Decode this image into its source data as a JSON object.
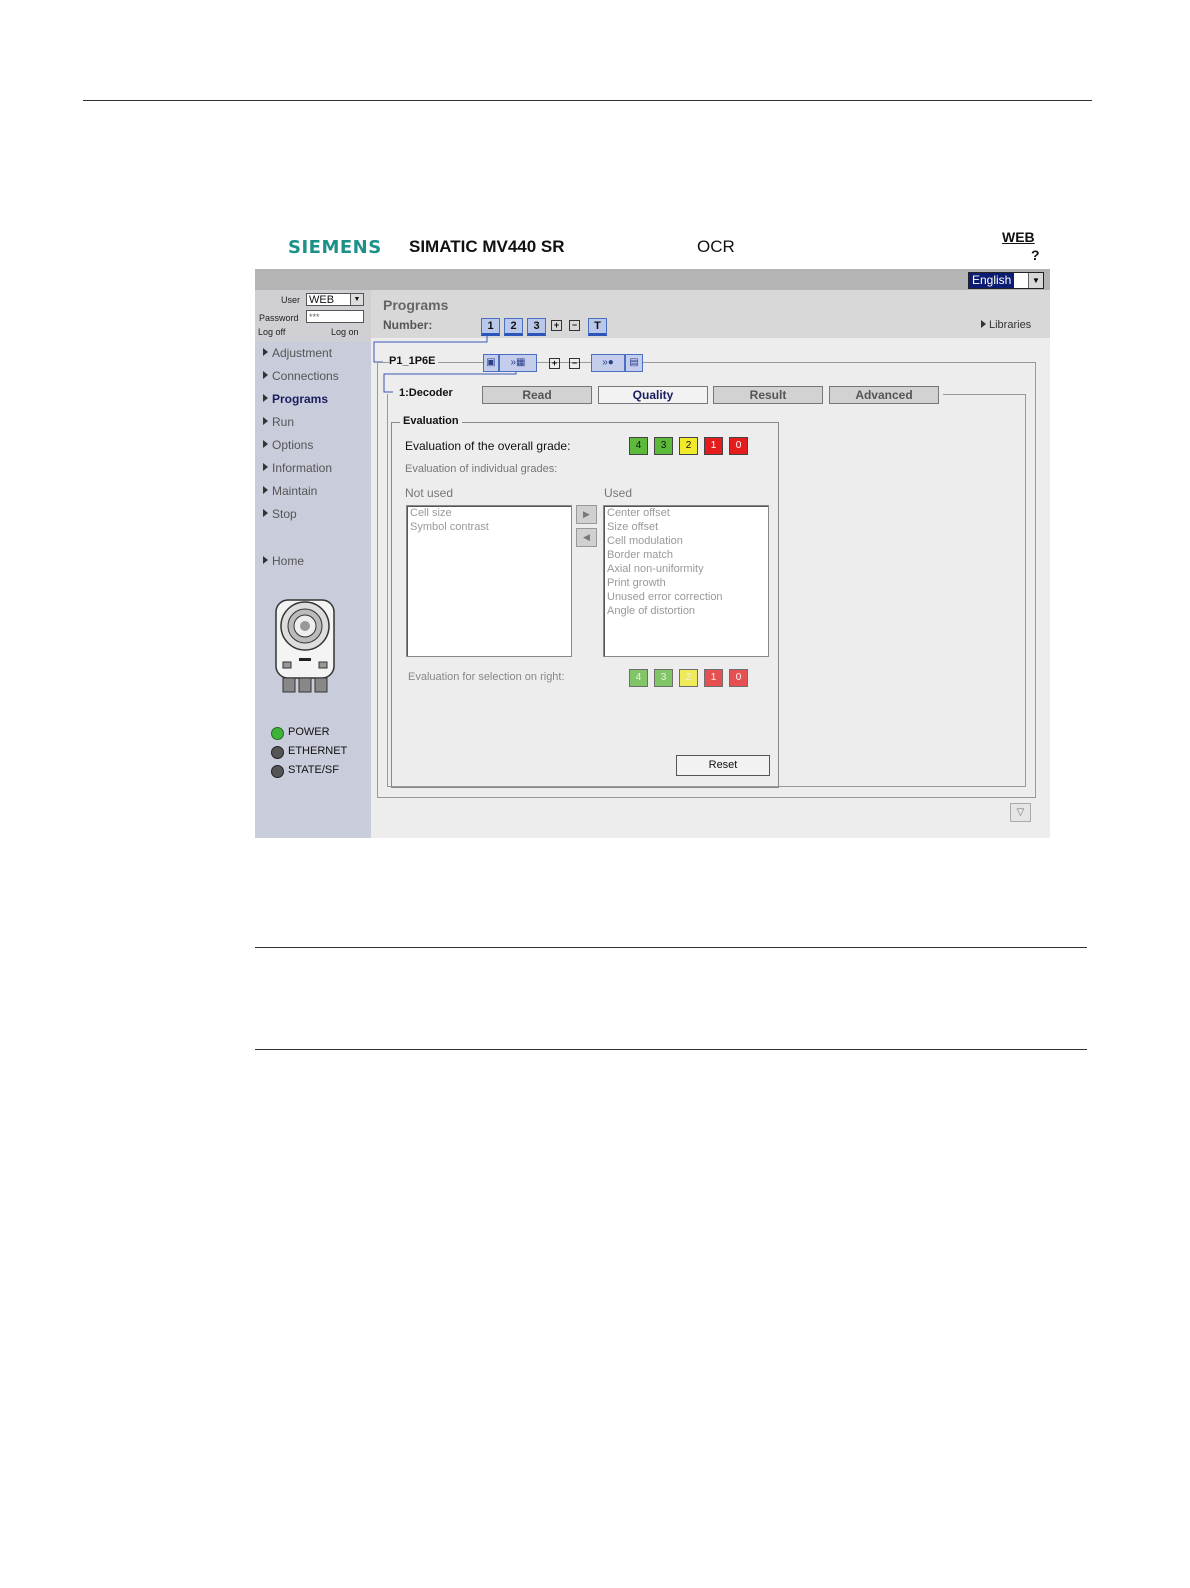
{
  "header": {
    "brand": "SIEMENS",
    "product": "SIMATIC MV440 SR",
    "module": "OCR",
    "web_link": "WEB",
    "help": "?",
    "language": "English"
  },
  "login": {
    "user_label": "User",
    "user_value": "WEB",
    "password_label": "Password",
    "password_value": "***",
    "logoff": "Log off",
    "logon": "Log on"
  },
  "nav": {
    "items": [
      "Adjustment",
      "Connections",
      "Programs",
      "Run",
      "Options",
      "Information",
      "Maintain",
      "Stop"
    ],
    "home": "Home",
    "active_index": 2
  },
  "status": {
    "items": [
      {
        "label": "POWER",
        "color": "#3fb23a"
      },
      {
        "label": "ETHERNET",
        "color": "#555555"
      },
      {
        "label": "STATE/SF",
        "color": "#555555"
      }
    ]
  },
  "main": {
    "title": "Programs",
    "number_label": "Number:",
    "numbers": [
      "1",
      "2",
      "3"
    ],
    "libraries": "Libraries",
    "program_name": "P1_1P6E",
    "step_name": "1:Decoder",
    "tabs": [
      "Read",
      "Quality",
      "Result",
      "Advanced"
    ],
    "selected_tab": "Quality"
  },
  "evaluation": {
    "title": "Evaluation",
    "overall_label": "Evaluation of the overall grade:",
    "individual_label": "Evaluation of individual grades:",
    "not_used_label": "Not used",
    "used_label": "Used",
    "not_used": [
      "Cell size",
      "Symbol contrast"
    ],
    "used": [
      "Center offset",
      "Size offset",
      "Cell modulation",
      "Border match",
      "Axial non-uniformity",
      "Print growth",
      "Unused error correction",
      "Angle of distortion"
    ],
    "selection_label": "Evaluation for selection on right:",
    "grades": [
      "4",
      "3",
      "2",
      "1",
      "0"
    ],
    "reset": "Reset"
  },
  "colors": {
    "brand": "#1b9188",
    "sidebar": "#c9ccda",
    "grade_green": "#5cba3a",
    "grade_yellow": "#f0ea2a",
    "grade_red": "#e41c1c"
  }
}
